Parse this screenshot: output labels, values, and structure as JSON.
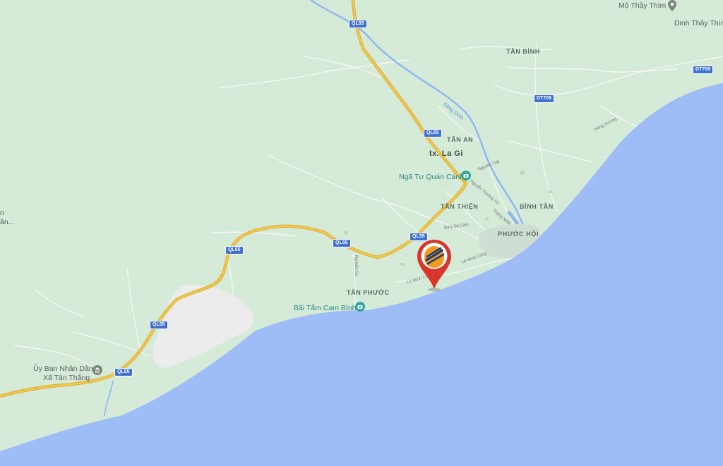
{
  "map": {
    "colors": {
      "land": "#d6ead8",
      "sea": "#9ebdf7",
      "highway": "#f2c94c",
      "highway_outline": "#d8a92c",
      "river": "#8fb7f2",
      "pin": "#d9362b",
      "logo_orange": "#f39a1d",
      "logo_navy": "#1d3e7a",
      "shield": "#3f6fd0"
    },
    "shields": {
      "ql55_a": "QL55",
      "ql55_b": "QL55",
      "ql55_c": "QL55",
      "ql55_d": "QL55",
      "ql55_e": "QL55",
      "ql55_f": "QL55",
      "dt709_a": "DT709",
      "dt709_b": "DT709"
    },
    "labels": {
      "mo_thay_thim": "Mộ Thầy Thím",
      "dinh_thay_thim": "Dinh Thầy Thím",
      "tan_binh": "TÂN BÌNH",
      "song_dinh": "Sông Dinh",
      "tan_an": "TÂN AN",
      "tx_la_gi": "tx. La Gi",
      "nga_tu": "Ngã Tư Quán Cánh",
      "tan_thien": "TÂN THIỆN",
      "binh_tan": "BÌNH TÂN",
      "phuoc_hoi": "PHƯỚC HỘI",
      "tan_phuoc": "TÂN PHƯỚC",
      "bai_tam": "Bãi Tắm Cam Bình",
      "uy_ban_line1": "Ủy Ban Nhân Dân",
      "uy_ban_line2": "Xã Tân Thắng",
      "left_edge_1": "n",
      "left_edge_2": "ân..."
    },
    "streets": {
      "hung_vuong": "Hùng Vương",
      "nguyen_trai": "Nguyễn Trãi",
      "nguyen_truong_to": "Nguyễn Trường Tộ",
      "thong_nhat": "Thống Nhất",
      "dinh_bo_linh": "Đinh Bộ Lĩnh",
      "le_minh_cong_a": "Lê Minh Công",
      "le_minh_cong_b": "Lê Minh Công",
      "nguyen_du": "Nguyễn Du"
    }
  }
}
